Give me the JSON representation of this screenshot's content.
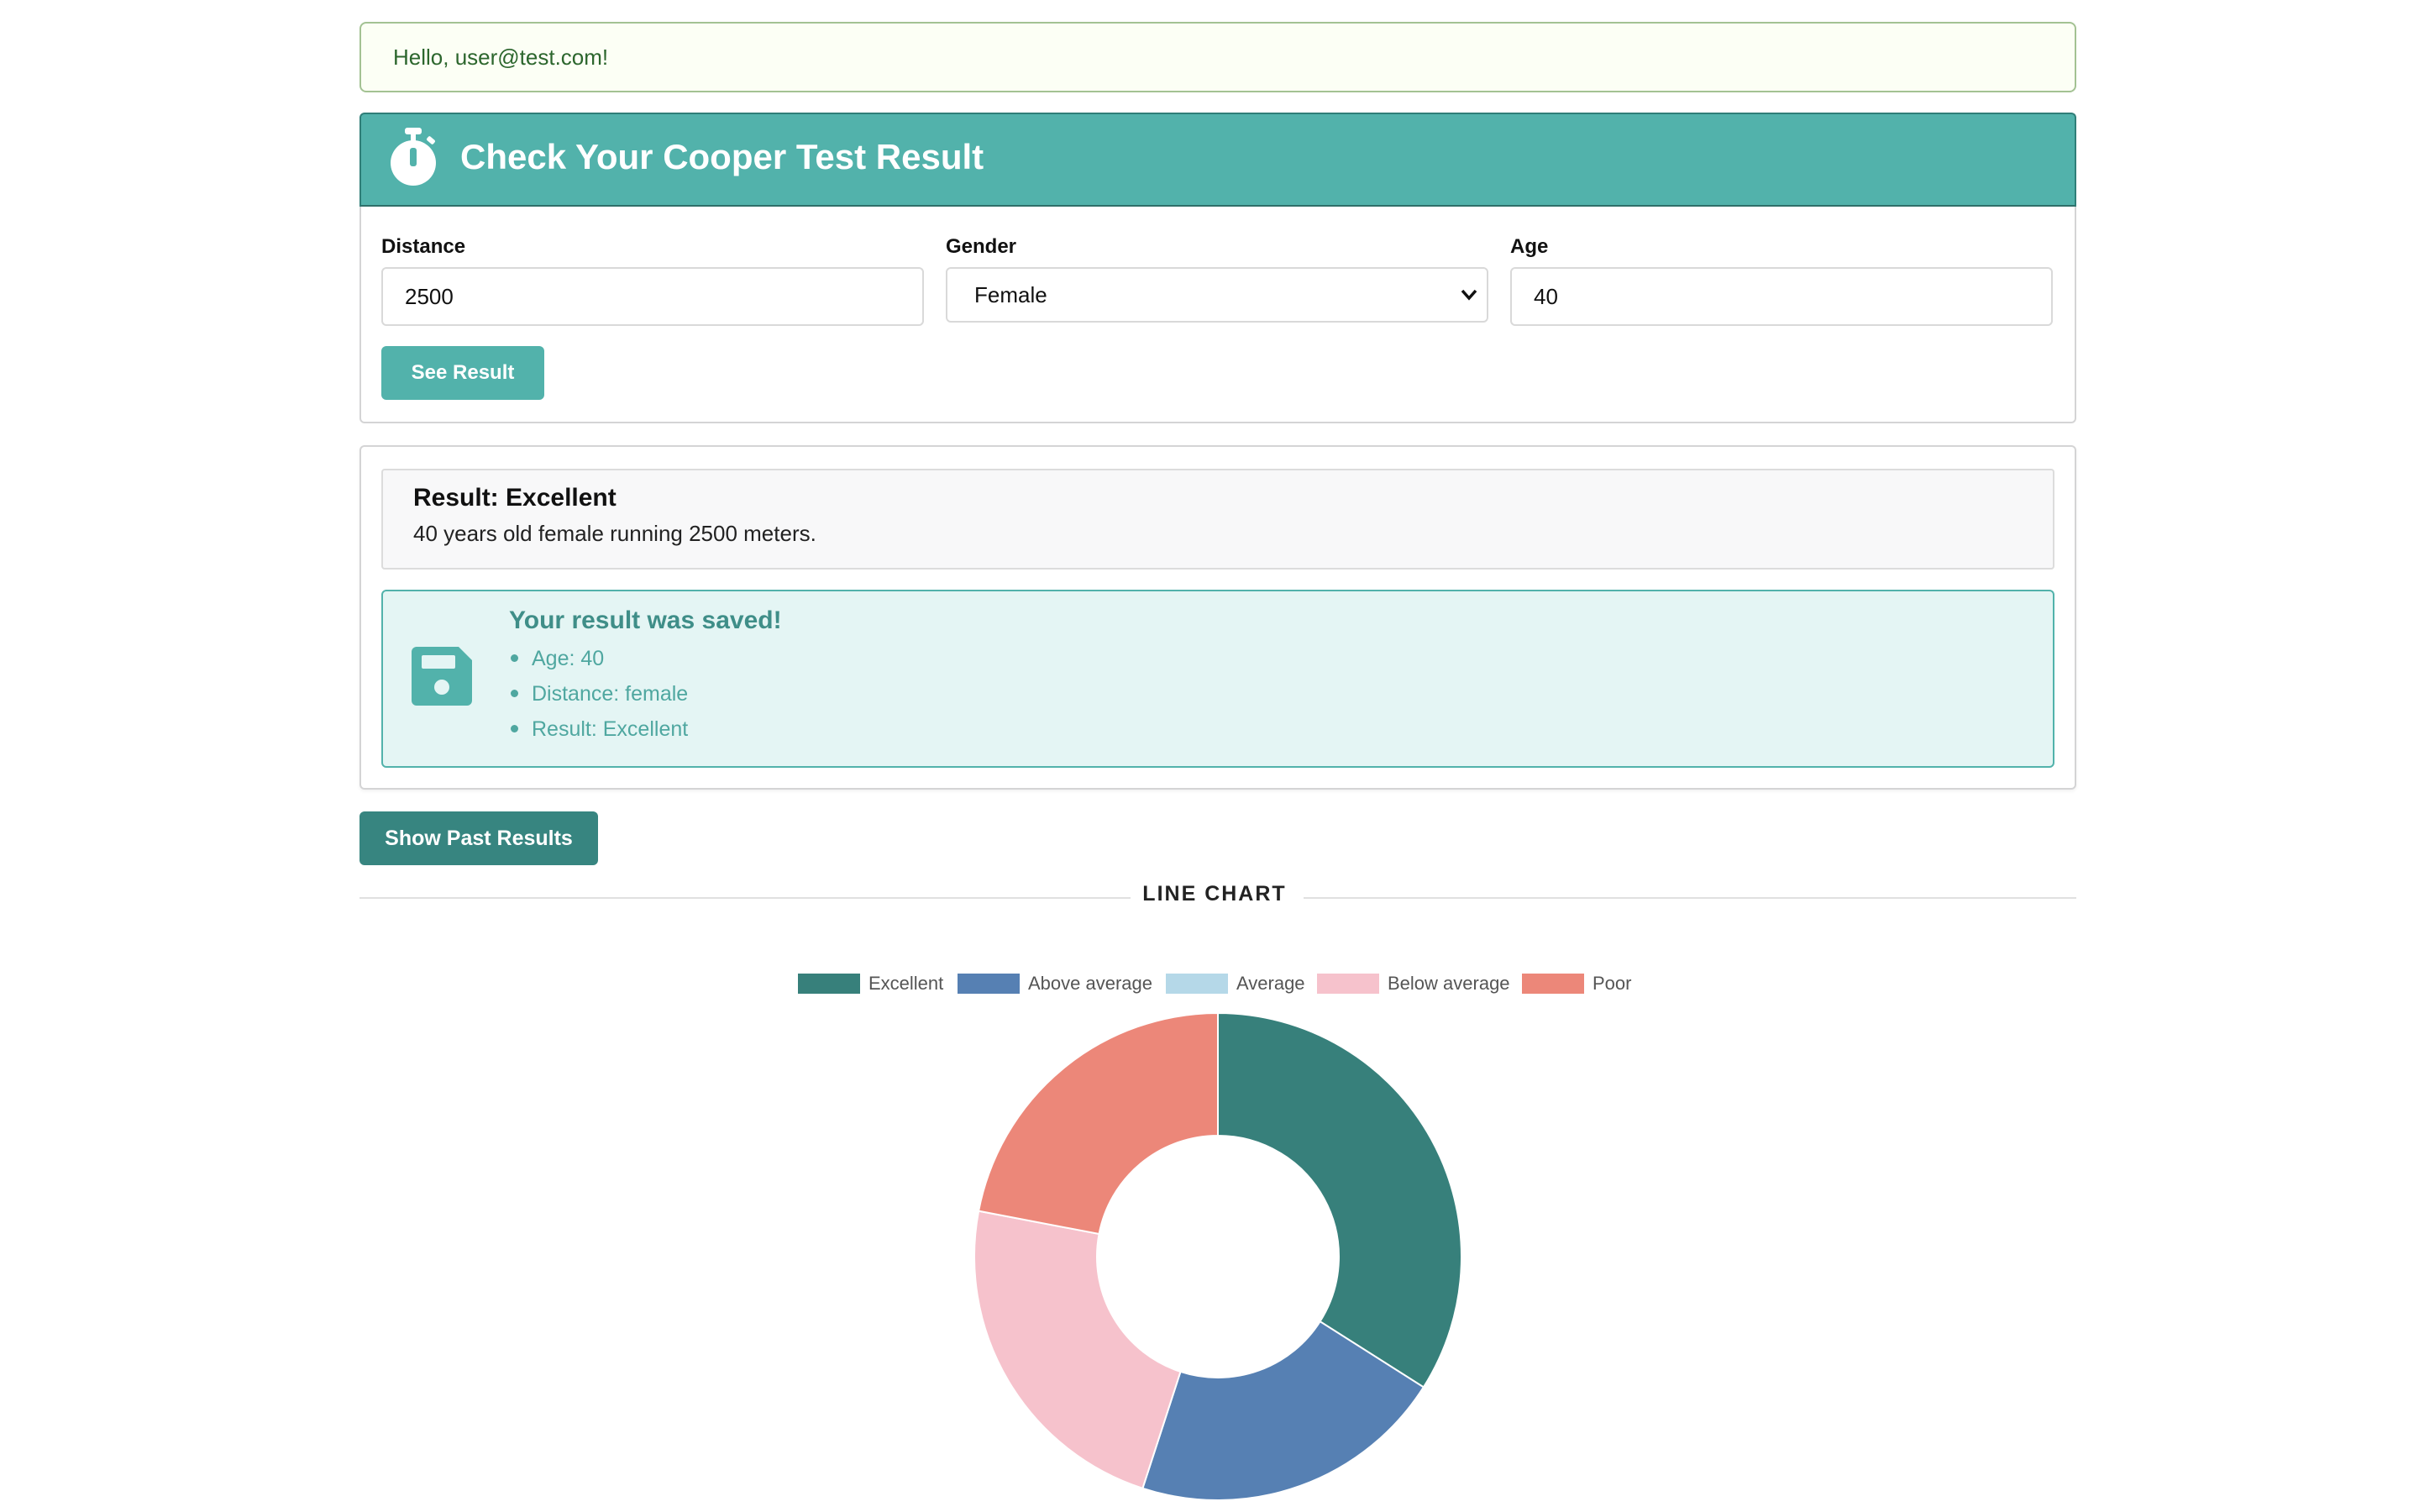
{
  "greeting": "Hello, user@test.com!",
  "header": {
    "title": "Check Your Cooper Test Result",
    "icon": "stopwatch-icon"
  },
  "form": {
    "distance_label": "Distance",
    "distance_value": "2500",
    "gender_label": "Gender",
    "gender_value": "Female",
    "age_label": "Age",
    "age_value": "40",
    "submit_label": "See Result"
  },
  "result": {
    "heading": "Result: Excellent",
    "description": "40 years old female running 2500 meters."
  },
  "saved": {
    "icon": "floppy-disk-icon",
    "title": "Your result was saved!",
    "items": [
      "Age: 40",
      "Distance: female",
      "Result: Excellent"
    ]
  },
  "past_results_button": "Show Past Results",
  "chart_section_title": "LINE CHART",
  "colors": {
    "primary": "#52b2ab",
    "primary_dark": "#378580",
    "greeting_border": "#a3c293",
    "saved_bg": "#e4f5f4"
  },
  "chart_data": {
    "type": "pie",
    "donut": true,
    "categories": [
      "Excellent",
      "Above average",
      "Average",
      "Below average",
      "Poor"
    ],
    "values": [
      34,
      21,
      0,
      23,
      22
    ],
    "colors": [
      "#37807b",
      "#5680b3",
      "#b5d8e8",
      "#f6c2cc",
      "#ec8779"
    ],
    "legend_position": "top"
  }
}
